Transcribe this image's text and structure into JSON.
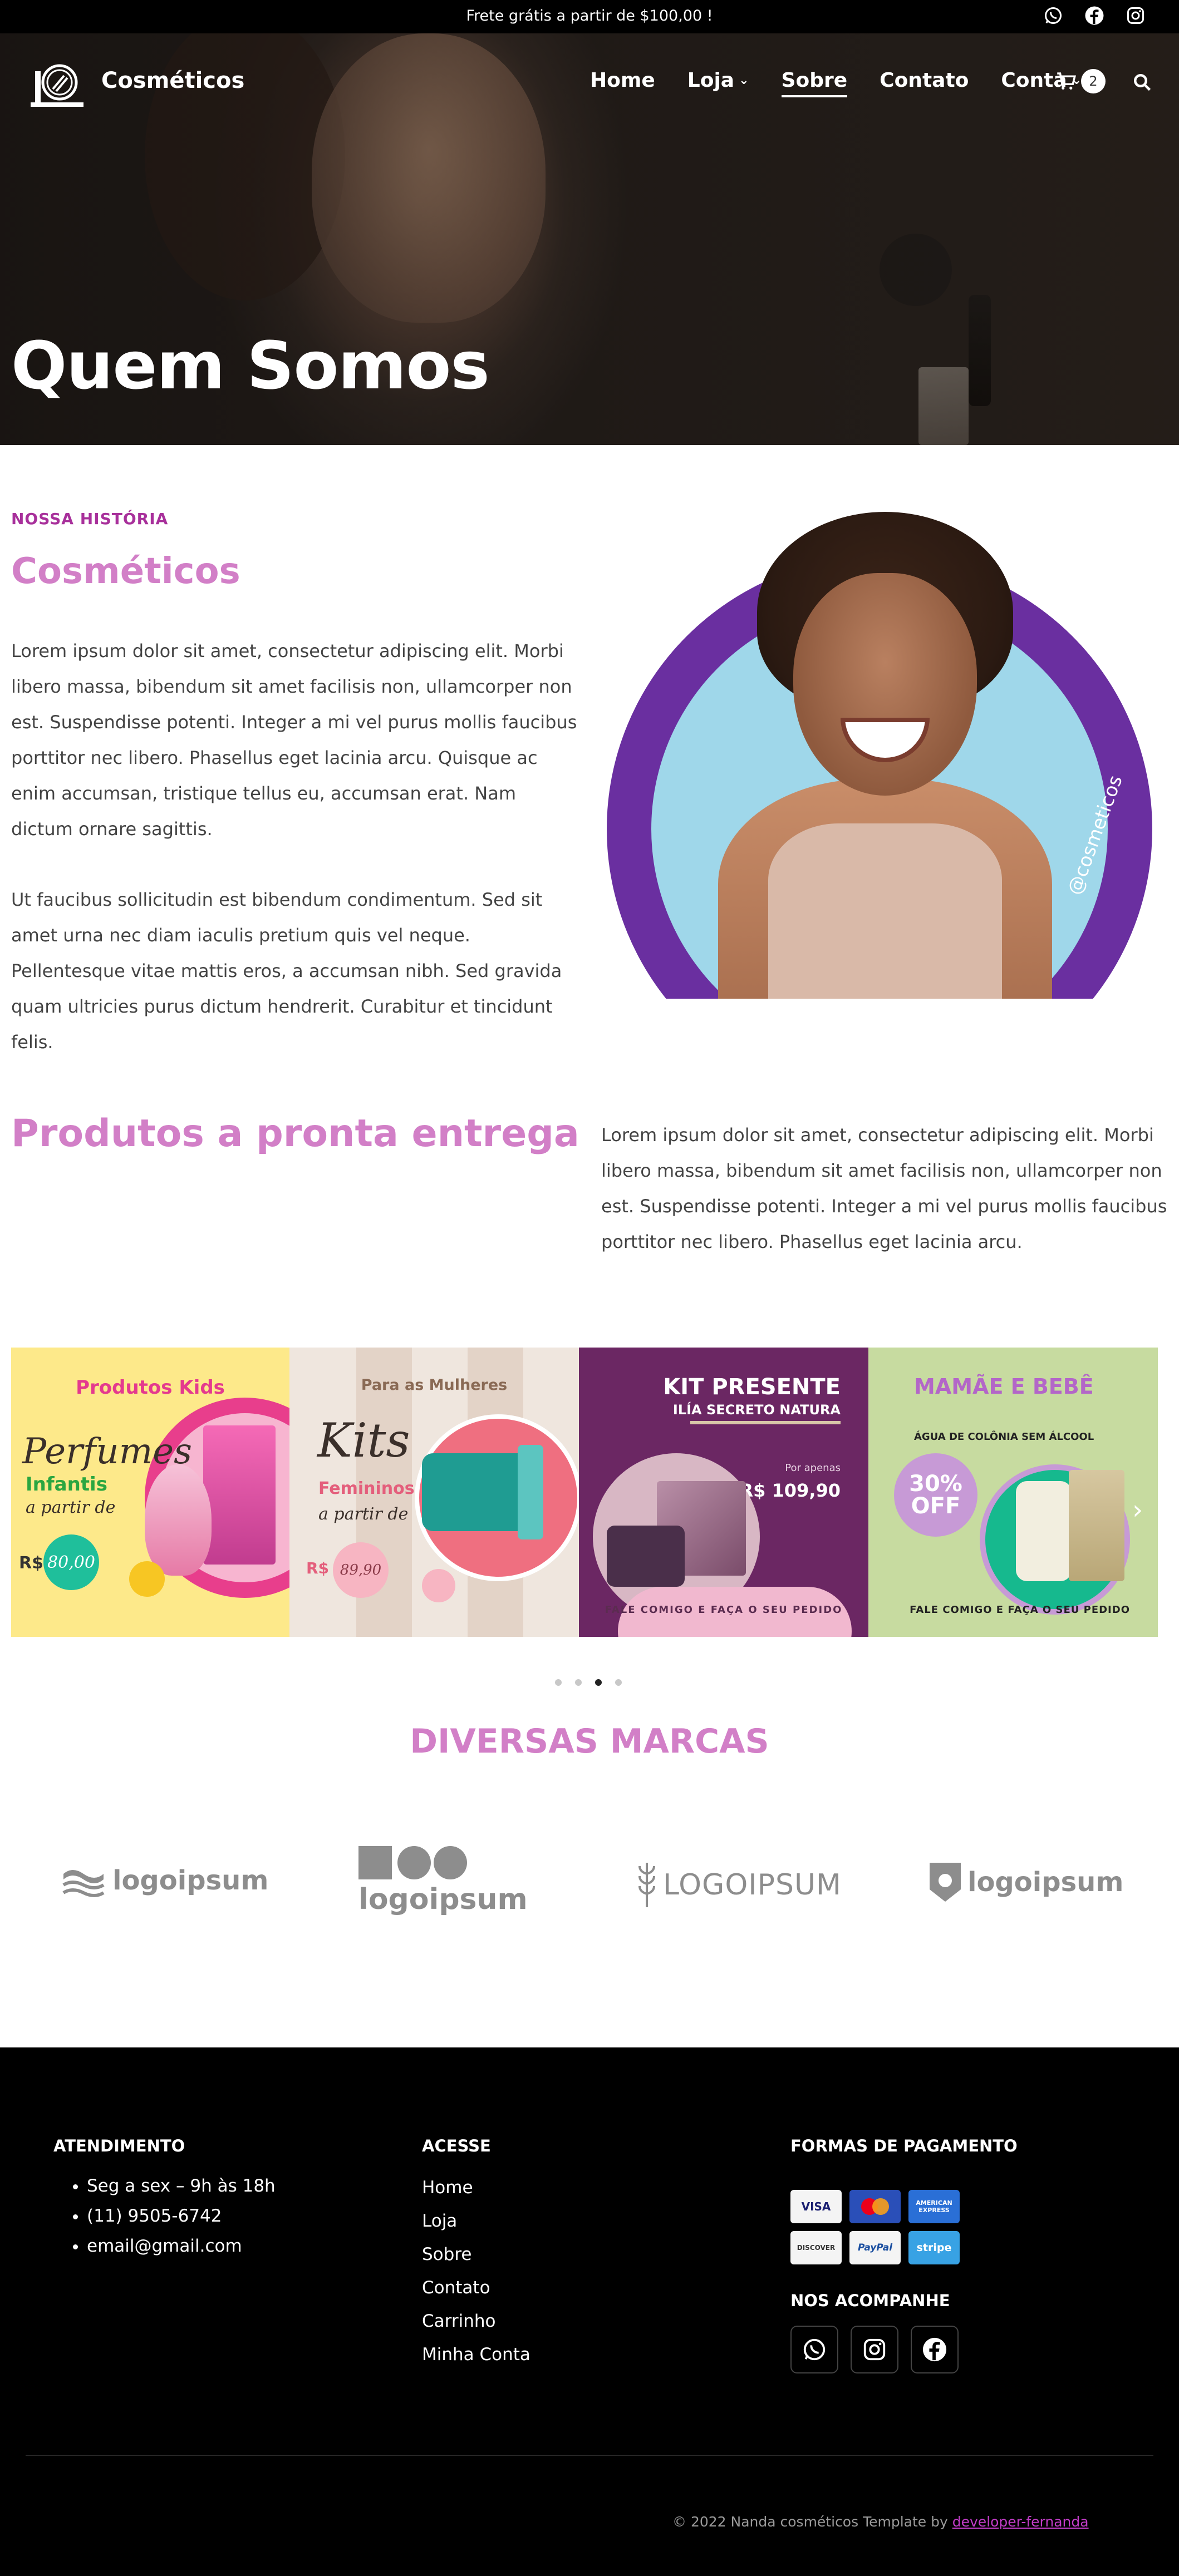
{
  "topbar": {
    "promo": "Frete grátis a partir de $100,00 !",
    "socials": [
      "whatsapp-icon",
      "facebook-icon",
      "instagram-icon"
    ]
  },
  "header": {
    "brand": "Cosméticos",
    "nav": [
      {
        "label": "Home",
        "dropdown": false,
        "active": false
      },
      {
        "label": "Loja",
        "dropdown": true,
        "active": false
      },
      {
        "label": "Sobre",
        "dropdown": false,
        "active": true
      },
      {
        "label": "Contato",
        "dropdown": false,
        "active": false
      },
      {
        "label": "Conta",
        "dropdown": true,
        "active": false
      }
    ],
    "cart_count": "2"
  },
  "hero": {
    "title": "Quem Somos"
  },
  "about": {
    "eyebrow": "NOSSA HISTÓRIA",
    "title": "Cosméticos",
    "p1": "Lorem ipsum dolor sit amet, consectetur adipiscing elit. Morbi libero massa, bibendum sit amet facilisis non, ullamcorper non est. Suspendisse potenti. Integer a mi vel purus mollis faucibus porttitor nec libero. Phasellus eget lacinia arcu. Quisque ac enim accumsan, tristique tellus eu, accumsan erat. Nam dictum ornare sagittis.",
    "p2": "Ut faucibus sollicitudin est bibendum condimentum. Sed sit amet urna nec diam iaculis pretium quis vel neque. Pellentesque vitae mattis eros, a accumsan nibh. Sed gravida quam ultricies purus dictum hendrerit. Curabitur et tincidunt felis.",
    "image_handle": "@cosmeticos"
  },
  "products": {
    "title": "Produtos a pronta entrega",
    "text": "Lorem ipsum dolor sit amet, consectetur adipiscing elit. Morbi libero massa, bibendum sit amet facilisis non, ullamcorper non est. Suspendisse potenti. Integer a mi vel purus mollis faucibus porttitor nec libero. Phasellus eget lacinia arcu.",
    "slides": {
      "kids": {
        "heading": "Produtos Kids",
        "script": "Perfumes",
        "sub": "Infantis",
        "from": "a partir de",
        "currency": "R$",
        "price": "80,00"
      },
      "women": {
        "heading": "Para as Mulheres",
        "script": "Kits",
        "sub": "Femininos",
        "from": "a partir de",
        "currency": "R$",
        "price": "89,90"
      },
      "gift": {
        "heading": "KIT PRESENTE",
        "sub": "ILÍA SECRETO NATURA",
        "label": "Por apenas",
        "price": "R$ 109,90",
        "cta": "FALE COMIGO E FAÇA O SEU PEDIDO"
      },
      "baby": {
        "heading": "MAMÃE E BEBÊ",
        "sub": "ÁGUA DE COLÔNIA SEM ÁLCOOL",
        "badge": "30% OFF",
        "cta": "FALE COMIGO E FAÇA O SEU PEDIDO"
      }
    },
    "active_dot": 3,
    "dot_count": 4
  },
  "brands": {
    "title": "DIVERSAS MARCAS",
    "logos": [
      "logoipsum",
      "logoipsum",
      "LOGOIPSUM",
      "logoipsum"
    ]
  },
  "footer": {
    "col1": {
      "heading": "ATENDIMENTO",
      "items": [
        "Seg a sex – 9h às 18h",
        "(11) 9505-6742",
        "email@gmail.com"
      ]
    },
    "col2": {
      "heading": "ACESSE",
      "links": [
        "Home",
        "Loja",
        "Sobre",
        "Contato",
        "Carrinho",
        "Minha Conta"
      ]
    },
    "col3": {
      "heading": "FORMAS DE PAGAMENTO",
      "cards": [
        "VISA",
        "Mastercard",
        "AMERICAN EXPRESS",
        "DISCOVER",
        "PayPal",
        "stripe"
      ],
      "follow": "NOS ACOMPANHE"
    },
    "copyright": "© 2022 Nanda cosméticos Template by ",
    "credit_link": "developer-fernanda"
  },
  "colors": {
    "accent": "#d27fc7",
    "eyebrow": "#a8309b",
    "footer_bg": "#000000",
    "link": "#c23cc8"
  }
}
